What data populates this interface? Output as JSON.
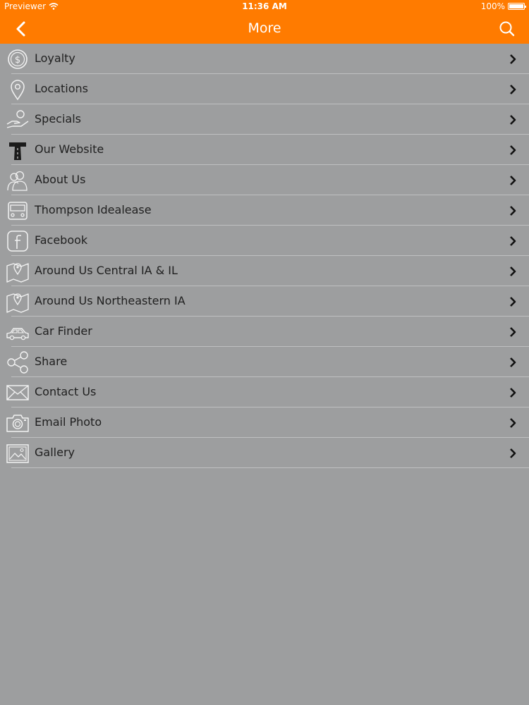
{
  "status": {
    "carrier": "Previewer",
    "time": "11:36 AM",
    "battery": "100%"
  },
  "nav": {
    "title": "More",
    "back_icon": "chevron-left-icon",
    "search_icon": "search-icon"
  },
  "colors": {
    "accent": "#ff7b00",
    "background": "#9d9e9f",
    "text": "#1f1f1f",
    "divider": "#bfc0c1"
  },
  "menu": {
    "items": [
      {
        "label": "Loyalty",
        "icon": "coin-icon"
      },
      {
        "label": "Locations",
        "icon": "map-pin-icon"
      },
      {
        "label": "Specials",
        "icon": "hand-coin-icon"
      },
      {
        "label": "Our Website",
        "icon": "road-t-icon"
      },
      {
        "label": "About Us",
        "icon": "people-icon"
      },
      {
        "label": "Thompson Idealease",
        "icon": "truck-icon"
      },
      {
        "label": "Facebook",
        "icon": "facebook-icon"
      },
      {
        "label": "Around Us Central IA & IL",
        "icon": "map-icon"
      },
      {
        "label": "Around Us Northeastern IA",
        "icon": "map-icon"
      },
      {
        "label": "Car Finder",
        "icon": "car-icon"
      },
      {
        "label": "Share",
        "icon": "share-icon"
      },
      {
        "label": "Contact Us",
        "icon": "envelope-icon"
      },
      {
        "label": "Email Photo",
        "icon": "camera-icon"
      },
      {
        "label": "Gallery",
        "icon": "image-icon"
      }
    ]
  }
}
